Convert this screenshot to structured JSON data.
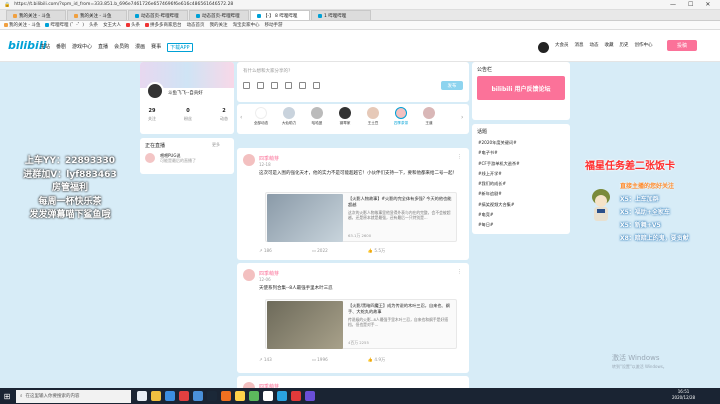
{
  "browser": {
    "url": "https://t.bilibili.com/?spm_id_from=333.851.b_696e7461726e6574696f6e616c486561646572.28",
    "controls": [
      "—",
      "☐",
      "✕"
    ]
  },
  "tabs": [
    "我的关注 - 斗鱼",
    "我的关注 - 斗鱼",
    "动态首页-哔哩哔哩",
    "动态首页-哔哩哔哩",
    "【-】 8 哔哩哔哩",
    "1 哔哩哔哩"
  ],
  "bookmarks": [
    "我的关注 - 斗鱼",
    "哔哩哔哩 (゜-゜)",
    "头条",
    "女王大人",
    "头条",
    "拼多多商家后台",
    "动态首页",
    "我的关注",
    "淘宝卖家中心",
    "移动手游"
  ],
  "nav": {
    "logo": "bilibili",
    "links": [
      "主站",
      "番剧",
      "游戏中心",
      "直播",
      "会员购",
      "漫画",
      "赛事",
      "下载APP"
    ],
    "right": [
      "大会员",
      "消息",
      "动态",
      "收藏",
      "历史",
      "创作中心"
    ],
    "post": "投稿"
  },
  "profile": {
    "name": "斗鱼飞飞--自贡好",
    "stats": [
      {
        "v": "29",
        "l": "关注"
      },
      {
        "v": "0",
        "l": "粉丝"
      },
      {
        "v": "2",
        "l": "动态"
      }
    ]
  },
  "live": {
    "title": "正在直播",
    "more": "更多",
    "name": "喂喂PUG说",
    "sub": "可能是最后的直播了"
  },
  "composer": {
    "placeholder": "有什么想和大家分享的?",
    "send": "发布"
  },
  "ups": [
    "全部动态",
    "大仙助力",
    "哈哈曼",
    "钢琴家",
    "王土豆",
    "四季茶茶",
    "王道"
  ],
  "feed1": {
    "name": "四季萌芽",
    "time": "12-18",
    "text": "这次可是入围的强化天才，他的实力不是可能超越它！小伙伴们支持一下，要和他都来给二号一起！",
    "vtitle": "【火影人物故事】#火影的完全体有多强? 今天的他也能超越",
    "vdesc": "这次的火影人物故事里他显得外表与内在的完整，会不会被超越，还是原本就是最强，还有最后一只特别是...",
    "vstats": "63.1万  2600",
    "act": [
      "186",
      "2022",
      "5.5万"
    ]
  },
  "feed2": {
    "name": "四季萌芽",
    "time": "12-06",
    "text": "天使系列合集--8人最强手里木叶三忍",
    "vtitle": "【火影/黑暗四魔王】成为传说的木叶三忍，自来也、纲手、大蛇丸的故事",
    "vdesc": "传说级的火影--8人最强手里木叶三忍，自来也和纲手是好搭档，但也是对手...",
    "vstats": "4百万  2255",
    "act": [
      "143",
      "1996",
      "4.9万"
    ]
  },
  "feed3": {
    "name": "四季萌芽"
  },
  "announcement": {
    "title": "公告栏",
    "banner": "bilibili 用户反馈论坛"
  },
  "topics": {
    "title": "话题",
    "items": [
      "#2020年度关键词#",
      "#电子书#",
      "#CF手游单机大逃杀#",
      "#线上开学#",
      "#我们的成长#",
      "#新年追剧#",
      "#搞笑视频大合集#",
      "#电竞#",
      "#每日#"
    ]
  },
  "overlay_left": [
    "上车YY：22893330",
    "进群加V：lyf883463",
    "房管福利",
    "每周一杯快乐茶",
    "发发弹幕喵下鲨鱼哦"
  ],
  "overlay_right": {
    "title": "福星任务差二张饭卡",
    "lines": [
      "直接主播的您好关注",
      "X5：上车加群",
      "X5：福助+全家车",
      "X5：新舞+V5",
      "X8：暗暗上的鬼，要贡献"
    ]
  },
  "windows": {
    "activate": "激活 Windows",
    "activate_sub": "转到\"设置\"以激活 Windows。"
  },
  "taskbar": {
    "search": "在这里输入你要搜索的内容",
    "time": "16:51",
    "date": "2020/12/28"
  }
}
